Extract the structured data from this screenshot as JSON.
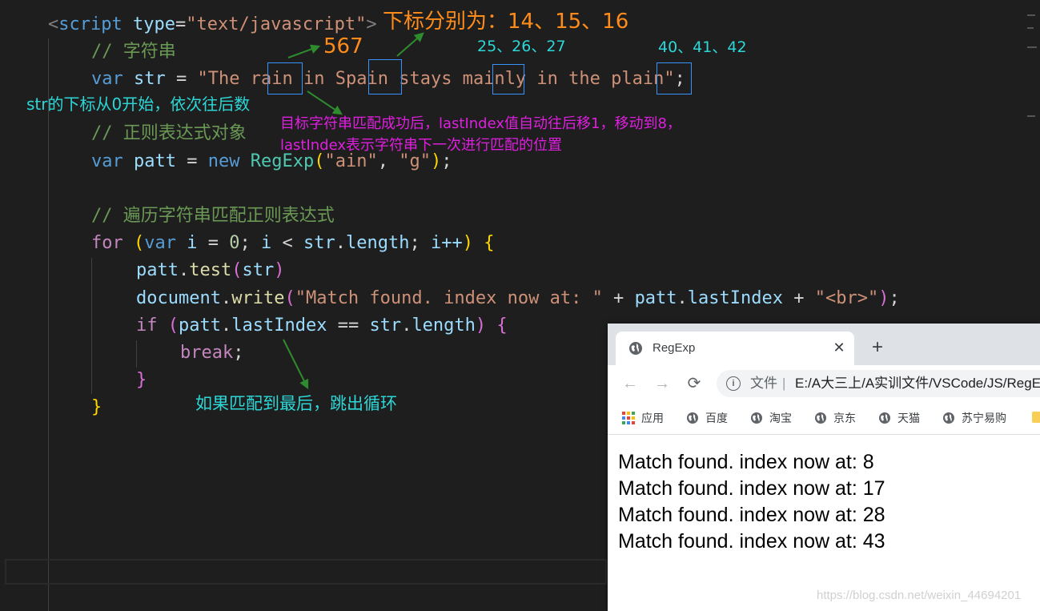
{
  "code": {
    "l1": {
      "lt": "<",
      "tag": "script",
      "attr": "type",
      "eq": "=",
      "val": "\"text/javascript\"",
      "gt": ">"
    },
    "l2": {
      "comment": "// 字符串"
    },
    "l3": {
      "kw": "var",
      "name": "str",
      "op": " = ",
      "str_open": "\"The r",
      "ain1": "ain",
      "mid1": " in Sp",
      "ain2": "ain",
      "mid2": " stays m",
      "ain3": "ain",
      "mid3": "ly in the pl",
      "ain4": "ain",
      "str_close": "\"",
      "semi": ";"
    },
    "l5": {
      "comment": "// 正则表达式对象"
    },
    "l6": {
      "kw": "var",
      "name": "patt",
      "op": " = ",
      "new": "new",
      "cls": "RegExp",
      "open": "(",
      "a1": "\"ain\"",
      "comma": ", ",
      "a2": "\"g\"",
      "close": ")",
      "semi": ";"
    },
    "l8": {
      "comment": "// 遍历字符串匹配正则表达式"
    },
    "l9": {
      "for": "for",
      "open": "(",
      "var": "var",
      "i": "i",
      "eq": " = ",
      "zero": "0",
      "semi1": "; ",
      "i2": "i",
      "lt": " < ",
      "str": "str",
      "dot": ".",
      "len": "length",
      "semi2": "; ",
      "inc": "i++",
      "close": ")",
      "brace": "{"
    },
    "l10": {
      "obj": "patt",
      "dot": ".",
      "fn": "test",
      "open": "(",
      "arg": "str",
      "close": ")"
    },
    "l11": {
      "obj": "document",
      "dot": ".",
      "fn": "write",
      "open": "(",
      "s1": "\"Match found. index now at: \"",
      "plus1": " + ",
      "obj2": "patt",
      "dot2": ".",
      "prop": "lastIndex",
      "plus2": " + ",
      "s2": "\"<br>\"",
      "close": ")",
      "semi": ";"
    },
    "l12": {
      "if": "if",
      "open": "(",
      "obj": "patt",
      "dot": ".",
      "prop": "lastIndex",
      "eq": " == ",
      "obj2": "str",
      "dot2": ".",
      "prop2": "length",
      "close": ")",
      "brace": "{"
    },
    "l13": {
      "brk": "break",
      "semi": ";"
    },
    "l14": {
      "brace": "}"
    },
    "l15": {
      "brace": "}"
    }
  },
  "annotations": {
    "subscripts_top": "下标分别为：14、15、16",
    "idx_567": "567",
    "idx_25": "25、26、27",
    "idx_40": "40、41、42",
    "str_index_note": "str的下标从0开始，依次往后数",
    "match_note_1": "目标字符串匹配成功后，lastIndex值自动往后移1，移动到8，",
    "match_note_2": "lastIndex表示字符串下一次进行匹配的位置",
    "break_note": "如果匹配到最后，跳出循环"
  },
  "browser": {
    "tab_title": "RegExp",
    "close_glyph": "✕",
    "new_tab_glyph": "+",
    "back_glyph": "←",
    "forward_glyph": "→",
    "reload_glyph": "⟳",
    "info_glyph": "i",
    "omni_label": "文件",
    "omni_sep": "|",
    "url": "E:/A大三上/A实训文件/VSCode/JS/RegExp",
    "bookmarks": [
      "应用",
      "百度",
      "淘宝",
      "京东",
      "天猫",
      "苏宁易购"
    ],
    "output": [
      "Match found. index now at: 8",
      "Match found. index now at: 17",
      "Match found. index now at: 28",
      "Match found. index now at: 43"
    ]
  },
  "watermark": "https://blog.csdn.net/weixin_44694201",
  "colors": {
    "editor_bg": "#1e1e1e",
    "annotation_orange": "#ff8c1a",
    "annotation_cyan": "#2ed7d7",
    "annotation_magenta": "#e01ee0",
    "arrow_green": "#2e8b2e",
    "highlight_box": "#3794ff"
  }
}
